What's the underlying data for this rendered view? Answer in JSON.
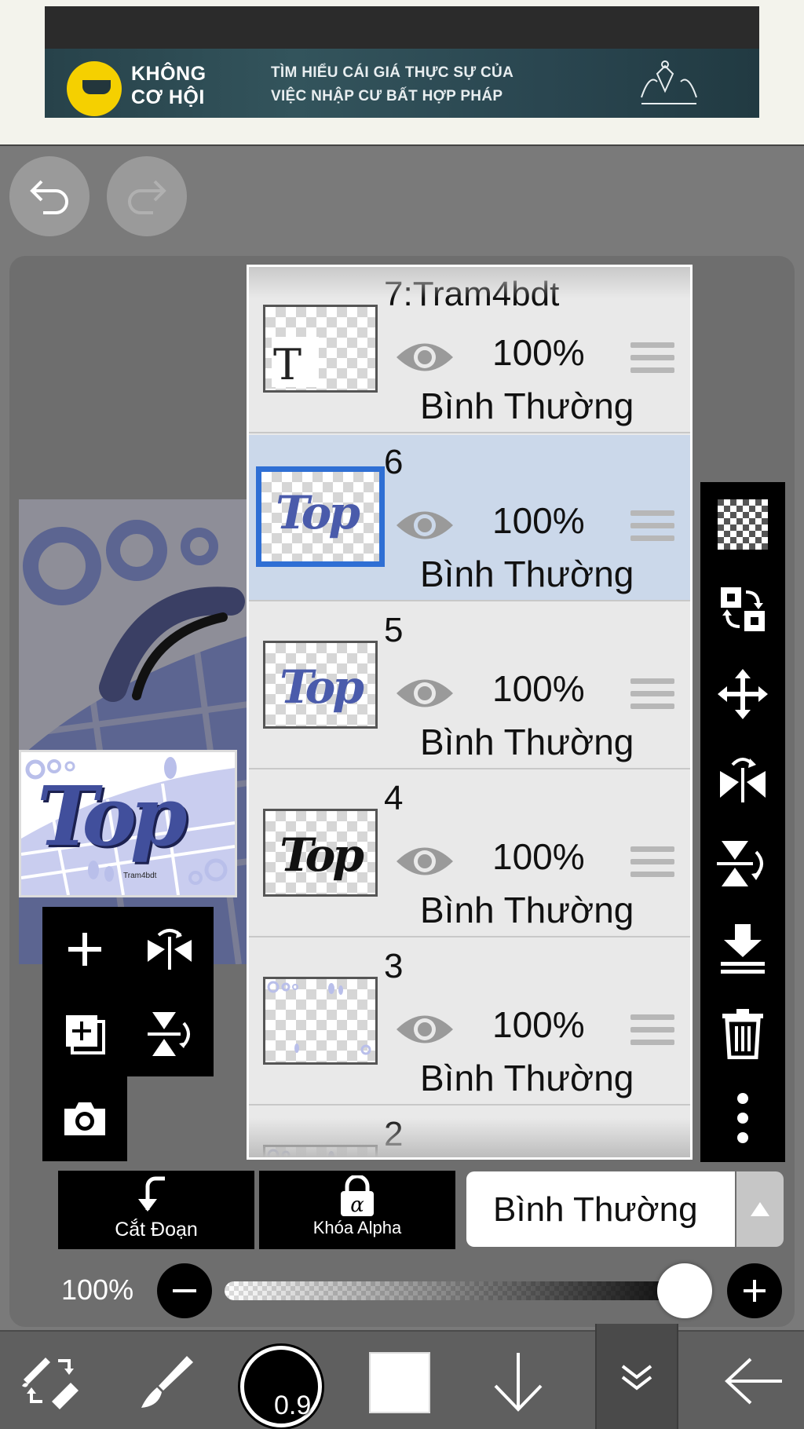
{
  "ad": {
    "brand_line1": "KHÔNG",
    "brand_line2": "CƠ HỘI",
    "text_line1": "TÌM HIỂU CÁI GIÁ THỰC SỰ CỦA",
    "text_line2": "VIỆC NHẬP CƯ BẤT HỢP PHÁP"
  },
  "layers": [
    {
      "name": "7:Tram4bdt",
      "opacity": "100%",
      "blend": "Bình Thường",
      "selected": false,
      "thumb": "text-T"
    },
    {
      "name": "6",
      "opacity": "100%",
      "blend": "Bình Thường",
      "selected": true,
      "thumb": "top-blue"
    },
    {
      "name": "5",
      "opacity": "100%",
      "blend": "Bình Thường",
      "selected": false,
      "thumb": "top-blue"
    },
    {
      "name": "4",
      "opacity": "100%",
      "blend": "Bình Thường",
      "selected": false,
      "thumb": "top-black"
    },
    {
      "name": "3",
      "opacity": "100%",
      "blend": "Bình Thường",
      "selected": false,
      "thumb": "dots"
    },
    {
      "name": "2",
      "opacity": "",
      "blend": "",
      "selected": false,
      "thumb": "partial"
    }
  ],
  "thumb_text": {
    "top": "Top",
    "T": "T",
    "preview_small": "Tram4bdt"
  },
  "actions": {
    "clip_label": "Cắt Đoạn",
    "alpha_lock_label": "Khóa Alpha",
    "blend_mode": "Bình Thường"
  },
  "opacity": {
    "label": "100%",
    "value": 100
  },
  "brush": {
    "size_label": "0.9"
  },
  "colors": {
    "selected_border": "#2f6fd4",
    "selected_row": "#cbd8ea",
    "layer_blue": "#4a5bab",
    "primary_color": "#ffffff"
  }
}
